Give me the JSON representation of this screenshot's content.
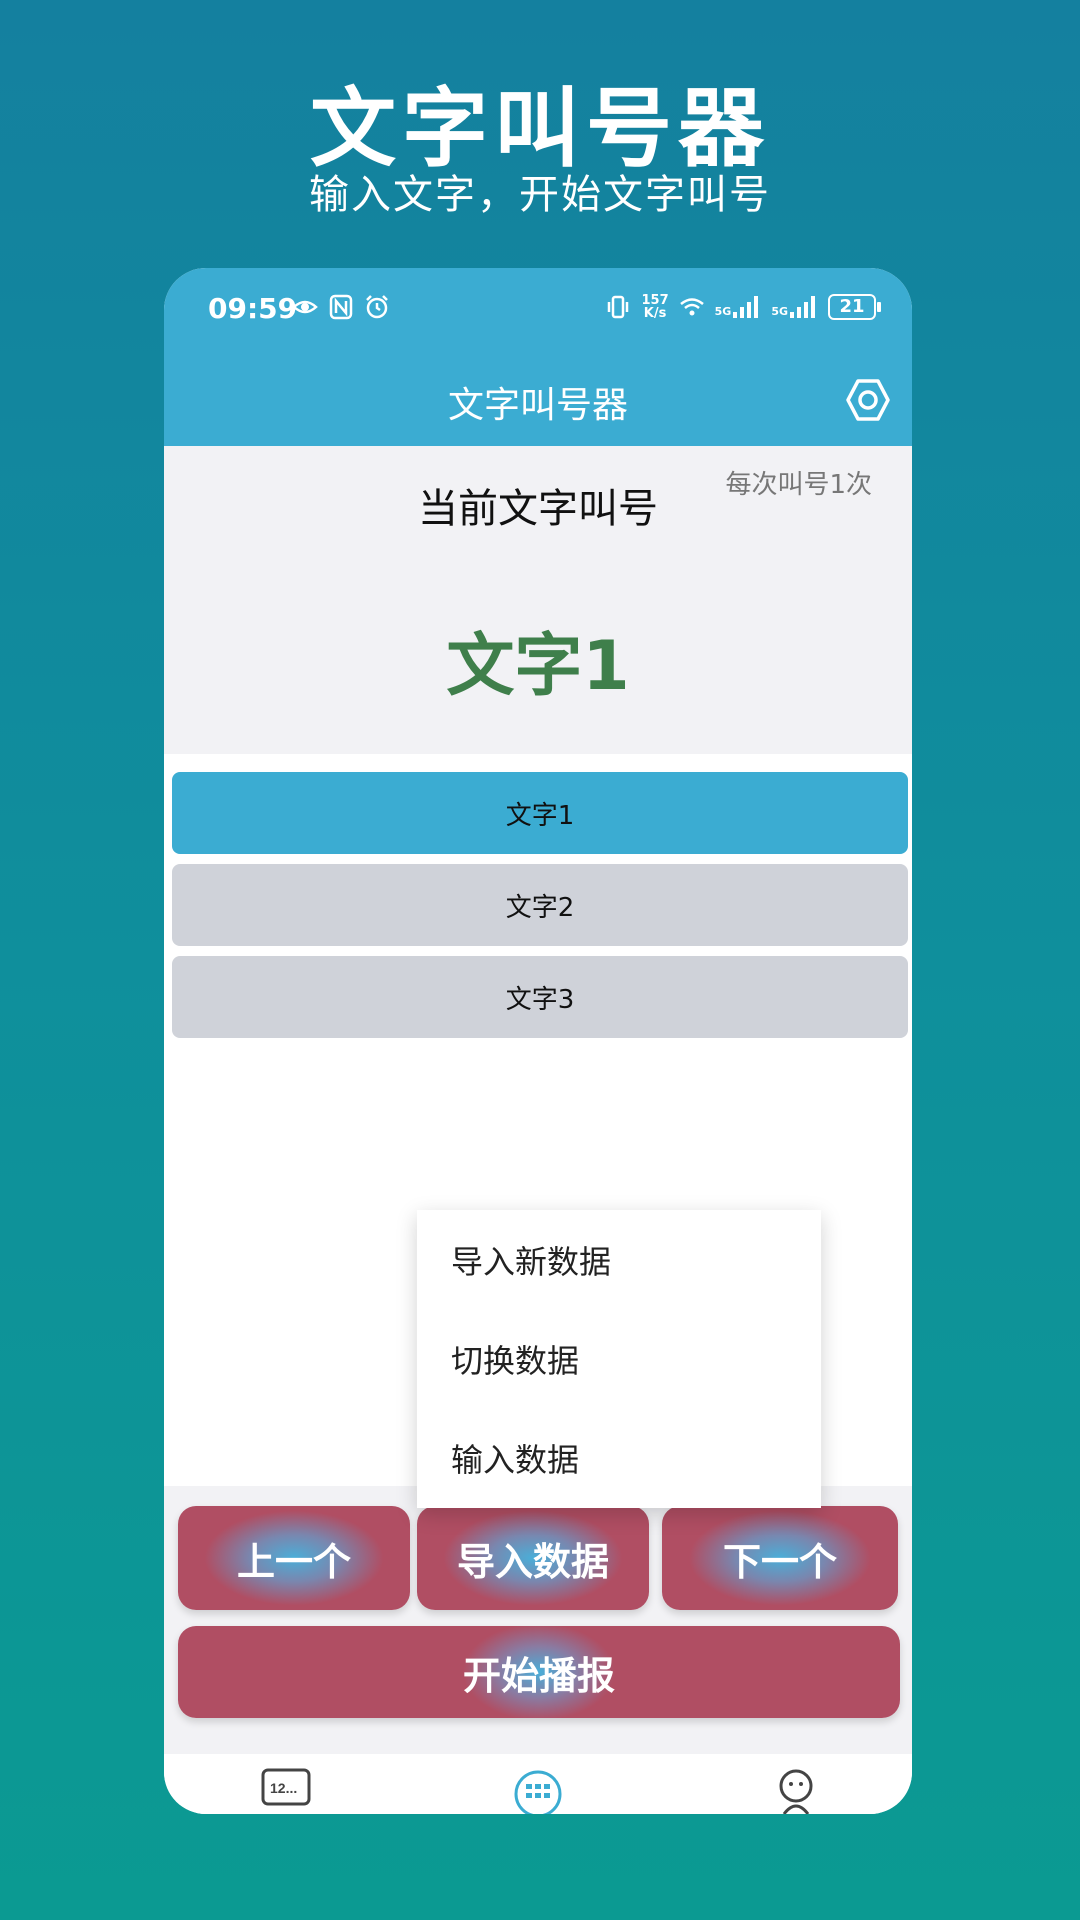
{
  "promo": {
    "title": "文字叫号器",
    "subtitle": "输入文字，开始文字叫号"
  },
  "status_bar": {
    "time": "09:59",
    "net_speed_value": "157",
    "net_speed_unit": "K/s",
    "network_1": "5G",
    "network_2": "5G",
    "battery": "21"
  },
  "app_bar": {
    "title": "文字叫号器",
    "settings_icon": "settings-hexagon-icon"
  },
  "current": {
    "label": "当前文字叫号",
    "per_call": "每次叫号1次",
    "value": "文字1"
  },
  "list": {
    "items": [
      "文字1",
      "文字2",
      "文字3"
    ],
    "active_index": 0
  },
  "menu": {
    "items": [
      "导入新数据",
      "切换数据",
      "输入数据"
    ]
  },
  "actions": {
    "prev": "上一个",
    "import": "导入数据",
    "next": "下一个",
    "start": "开始播报"
  },
  "bottom_nav": {
    "icons": [
      "number-keypad-icon",
      "grid-dial-icon",
      "profile-icon"
    ],
    "nav_1_text": "12..."
  },
  "colors": {
    "accent": "#3bacd2",
    "current_value": "#3f7f4b",
    "button_red": "#b04e63",
    "list_inactive": "#cfd2d9"
  }
}
